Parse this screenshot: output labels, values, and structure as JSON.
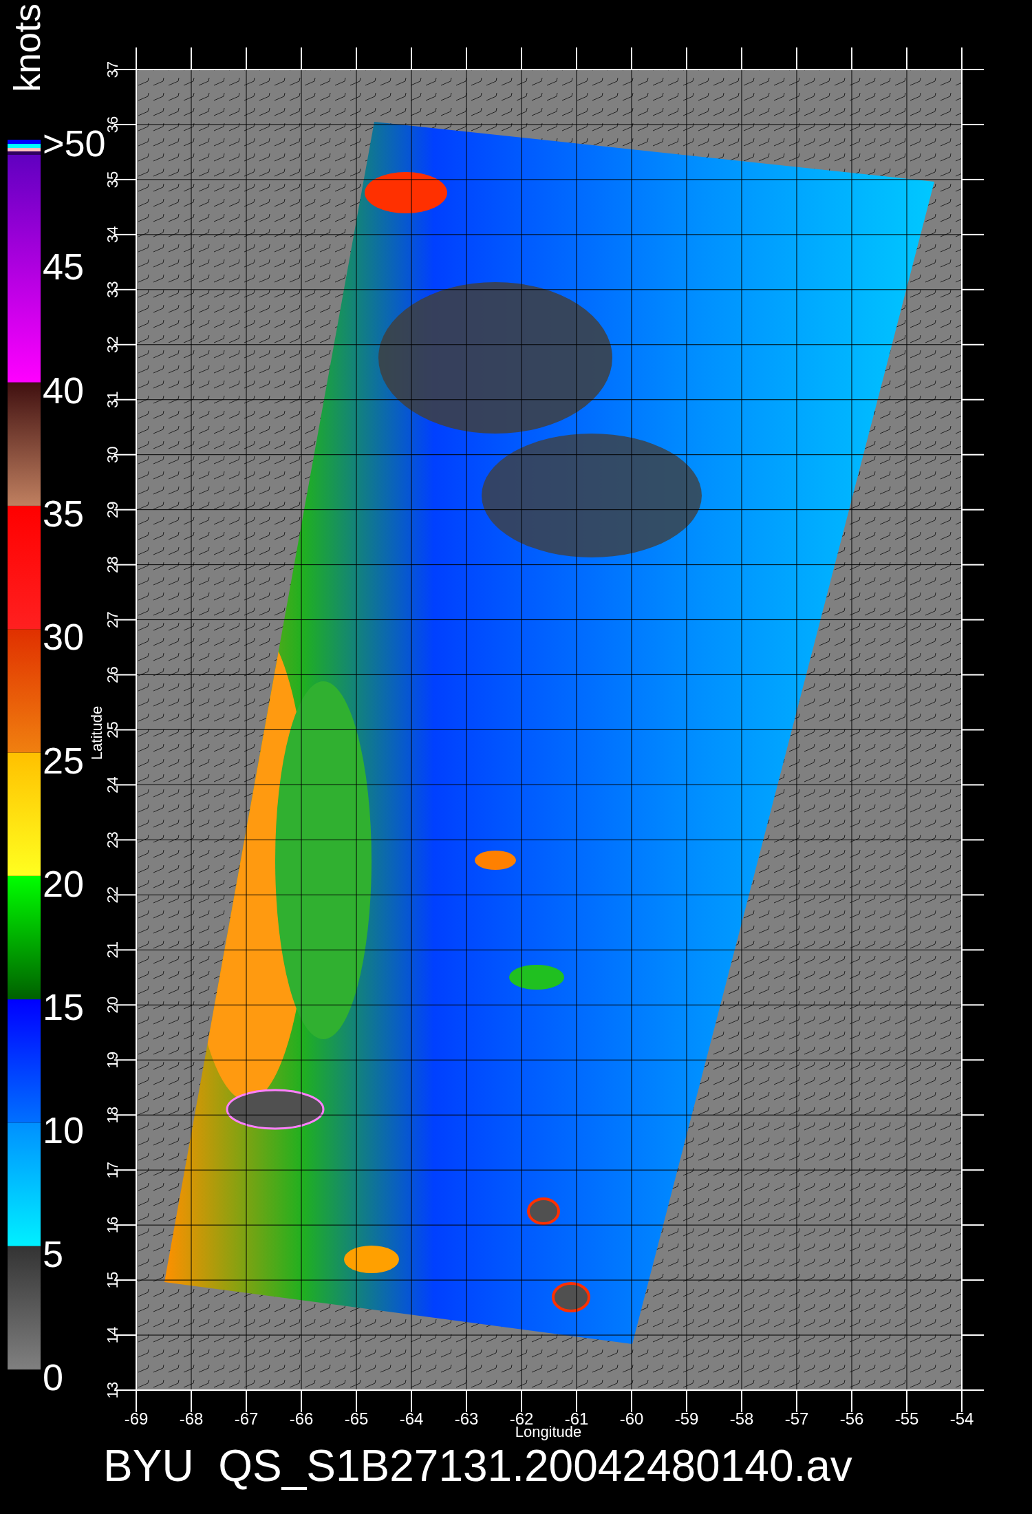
{
  "colorbar": {
    "unit": "knots",
    "labels": [
      ">50",
      "45",
      "40",
      "35",
      "30",
      "25",
      "20",
      "15",
      "10",
      "5",
      "0"
    ]
  },
  "map": {
    "y_axis": {
      "label": "Latitude",
      "ticks": [
        "37",
        "36",
        "35",
        "34",
        "33",
        "32",
        "31",
        "30",
        "29",
        "28",
        "27",
        "26",
        "25",
        "24",
        "23",
        "22",
        "21",
        "20",
        "19",
        "18",
        "17",
        "16",
        "15",
        "14",
        "13"
      ]
    },
    "x_axis": {
      "label": "Longitude",
      "ticks": [
        "-69",
        "-68",
        "-67",
        "-66",
        "-65",
        "-64",
        "-63",
        "-62",
        "-61",
        "-60",
        "-59",
        "-58",
        "-57",
        "-56",
        "-55",
        "-54"
      ]
    }
  },
  "title": "BYU  QS_S1B27131.20042480140.av"
}
